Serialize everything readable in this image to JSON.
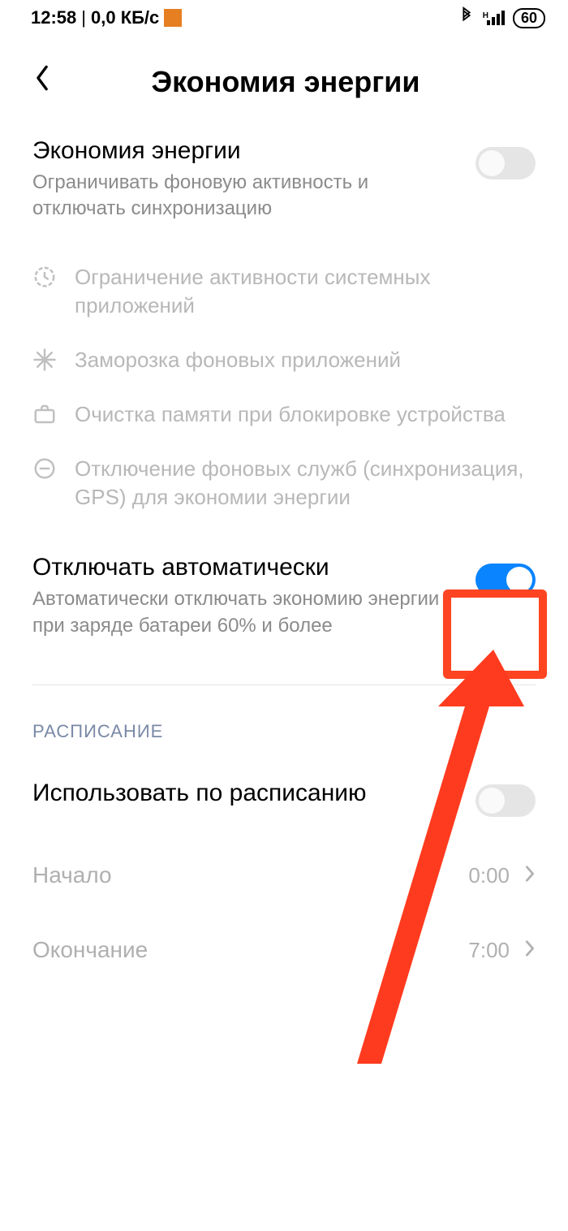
{
  "status": {
    "time": "12:58",
    "net_speed": "0,0 КБ/с",
    "battery": "60"
  },
  "header": {
    "title": "Экономия энергии"
  },
  "battery_saver": {
    "title": "Экономия энергии",
    "subtitle": "Ограничивать фоновую активность и отключать синхронизацию",
    "features": [
      "Ограничение активности системных приложений",
      "Заморозка фоновых приложений",
      "Очистка памяти при блокировке устройства",
      "Отключение фоновых служб (синхронизация, GPS) для экономии энергии"
    ]
  },
  "auto_disable": {
    "title": "Отключать автоматически",
    "subtitle": "Автоматически отключать экономию энергии при заряде батареи 60% и более"
  },
  "schedule": {
    "section": "РАСПИСАНИЕ",
    "use_schedule": "Использовать по расписанию",
    "start_label": "Начало",
    "start_value": "0:00",
    "end_label": "Окончание",
    "end_value": "7:00"
  }
}
